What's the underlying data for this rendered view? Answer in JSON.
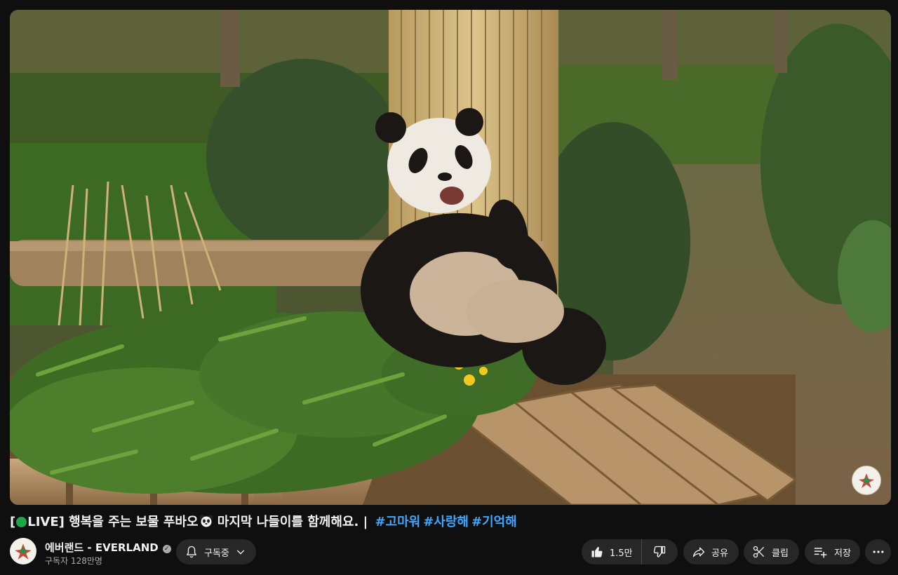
{
  "video": {
    "title_badge_open": "[",
    "title_badge_text": "LIVE]",
    "title_main": " 행복을 주는 보물 푸바오",
    "title_after_emoji": " 마지막 나들이를 함께해요. |",
    "hashtags": [
      "#고마워",
      "#사랑해",
      "#기억해"
    ],
    "emoji_icon": "panda-face-icon",
    "live_dot_icon": "green-circle-icon",
    "watermark_icon": "everland-logo-icon"
  },
  "channel": {
    "name": "에버랜드 - EVERLAND",
    "verified_icon": "verified-check-icon",
    "subscribers": "구독자 128만명",
    "subscribe_label": "구독중"
  },
  "actions": {
    "like_count": "1.5만",
    "share_label": "공유",
    "clip_label": "클립",
    "save_label": "저장"
  },
  "icons": [
    "bell-icon",
    "chevron-down-icon",
    "thumb-up-icon",
    "thumb-down-icon",
    "share-arrow-icon",
    "scissors-icon",
    "playlist-add-icon",
    "more-horiz-icon"
  ],
  "colors": {
    "background": "#0f0f0f",
    "pill": "#272727",
    "hashtag": "#3ea6ff",
    "live_dot": "#1ea44a",
    "secondary_text": "#aaaaaa"
  }
}
